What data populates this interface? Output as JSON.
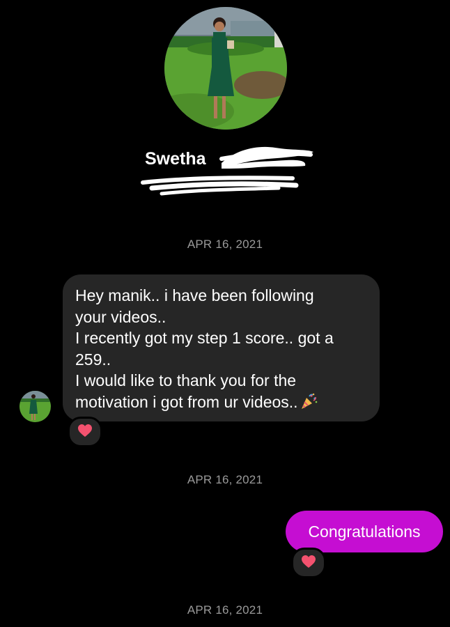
{
  "profile": {
    "name_visible": "Swetha"
  },
  "dates": [
    "APR 16, 2021",
    "APR 16, 2021",
    "APR 16, 2021"
  ],
  "messages": {
    "incoming": {
      "lines": [
        "Hey manik.. i have been following",
        "your videos..",
        "I recently got my step 1 score.. got a",
        "259..",
        "I would like to thank you for the",
        "motivation i got from ur videos.."
      ],
      "emoji": "party-popper-icon",
      "reaction": "heart-icon"
    },
    "outgoing": {
      "text": "Congratulations",
      "reaction": "heart-icon"
    }
  },
  "colors": {
    "background": "#000000",
    "incoming_bubble": "#262626",
    "outgoing_bubble": "#c50ed2",
    "date_text": "#9a9a9a",
    "heart": "#f4526f"
  }
}
